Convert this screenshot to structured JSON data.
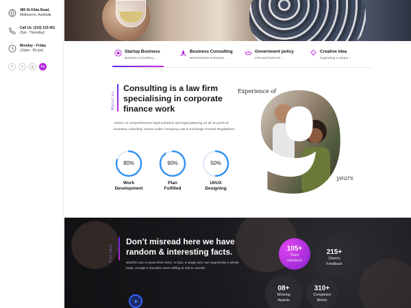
{
  "sidebar": {
    "address": {
      "line1": "380 St Kilda Road,",
      "line2": "Melbourne, Australia"
    },
    "phone": {
      "line1": "Call Us: (210) 123-451",
      "line2": "(Sat - Thursday)"
    },
    "hours": {
      "line1": "Monday - Friday",
      "line2": "(10am - 05 pm)"
    },
    "socials": [
      {
        "icon": "facebook-icon",
        "glyph": "f"
      },
      {
        "icon": "twitter-icon",
        "glyph": "t"
      },
      {
        "icon": "instagram-icon",
        "glyph": "◎"
      },
      {
        "icon": "behance-icon",
        "glyph": "Be"
      }
    ]
  },
  "tabs": [
    {
      "title": "Startup Business",
      "subtitle": "Business Consulting ..."
    },
    {
      "title": "Business Consulting",
      "subtitle": "Best business enterprise ..."
    },
    {
      "title": "Government policy",
      "subtitle": "First and foremost ..."
    },
    {
      "title": "Creative idea",
      "subtitle": "Supporting a unique ..."
    }
  ],
  "about": {
    "label": "About us",
    "heading": "Consulting is a law firm specialising in corporate finance work",
    "paragraph": "Advice on comprehensive legal solutions and legal planning on all as pects of business, including: issues under Company Law & Exchange Control Regulations.",
    "progress": [
      {
        "value": "80%",
        "percent": 80,
        "label1": "Work",
        "label2": "Development"
      },
      {
        "value": "90%",
        "percent": 90,
        "label1": "Plan",
        "label2": "Fulfilled"
      },
      {
        "value": "50%",
        "percent": 50,
        "label1": "UI/UX",
        "label2": "Designing"
      }
    ],
    "experience_prefix": "Experience of",
    "experience_number": "9",
    "experience_suffix": "years"
  },
  "facts": {
    "label": "Fun fact",
    "heading": "Don’t misread here we have random & interesting facts.",
    "paragraph": "Starfish can re-grow their arms. In fact, a single arm can regenerate a whole body. Google's founders were willing to sell & consult.",
    "stats": [
      {
        "number": "105+",
        "label1": "Team",
        "label2": "members"
      },
      {
        "number": "215+",
        "label1": "Client's",
        "label2": "Feedback"
      },
      {
        "number": "08+",
        "label1": "Winning",
        "label2": "Awards"
      },
      {
        "number": "310+",
        "label1": "Completed",
        "label2": "Works"
      }
    ]
  },
  "colors": {
    "accent": "#b026d6",
    "gradient_start": "#5a2ee6",
    "gradient_end": "#c62ad6",
    "ring": "#2f8ff2"
  }
}
